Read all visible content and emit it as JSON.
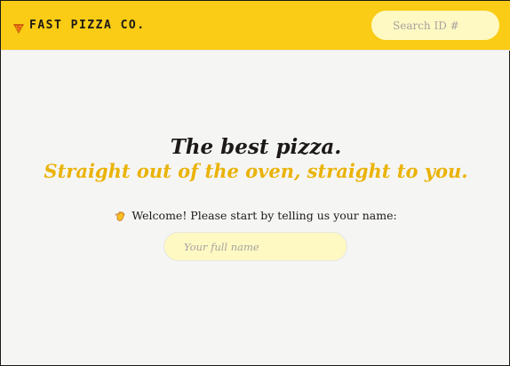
{
  "header": {
    "logo_icon": "pizza-icon",
    "logo_text": "FAST PIZZA CO.",
    "search_placeholder": "Search ID #",
    "accent_color": "#facc15"
  },
  "home": {
    "headline": "The best pizza.",
    "subheadline": "Straight out of the oven, straight to you.",
    "welcome_icon": "waving-hand-icon",
    "welcome_text": "Welcome! Please start by telling us your name:",
    "name_placeholder": "Your full name",
    "subheadline_color": "#eab308"
  }
}
